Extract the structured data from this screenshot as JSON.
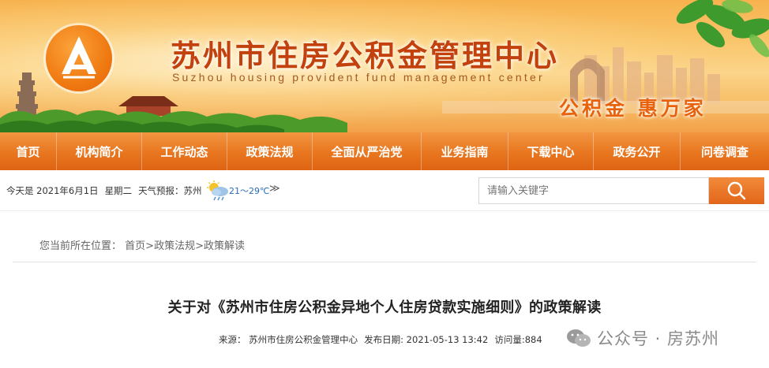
{
  "banner": {
    "title": "苏州市住房公积金管理中心",
    "subtitle": "Suzhou housing provident fund management center",
    "slogan": "公积金 惠万家"
  },
  "nav": {
    "items": [
      "首页",
      "机构简介",
      "工作动态",
      "政策法规",
      "全面从严治党",
      "业务指南",
      "下载中心",
      "政务公开",
      "问卷调查"
    ]
  },
  "info": {
    "date": "今天是 2021年6月1日",
    "weekday": "星期二",
    "forecast_label": "天气预报：苏州",
    "temperature": "21～29℃",
    "more": "≫"
  },
  "search": {
    "placeholder": "请输入关键字",
    "button_icon": "search-icon"
  },
  "breadcrumb": {
    "prefix": "您当前所在位置：",
    "items": [
      "首页",
      "政策法规",
      "政策解读"
    ],
    "separator": ">"
  },
  "article": {
    "title": "关于对《苏州市住房公积金异地个人住房贷款实施细则》的政策解读",
    "source": "来源： 苏州市住房公积金管理中心",
    "published": "发布日期: 2021-05-13 13:42",
    "views": "访问量:884"
  },
  "watermark": {
    "text": "公众号 · 房苏州",
    "icon": "wechat-icon"
  },
  "colors": {
    "nav": "#e8761f",
    "title": "#c2410c",
    "slogan": "#e8620c",
    "search_button": "#e2661a"
  }
}
